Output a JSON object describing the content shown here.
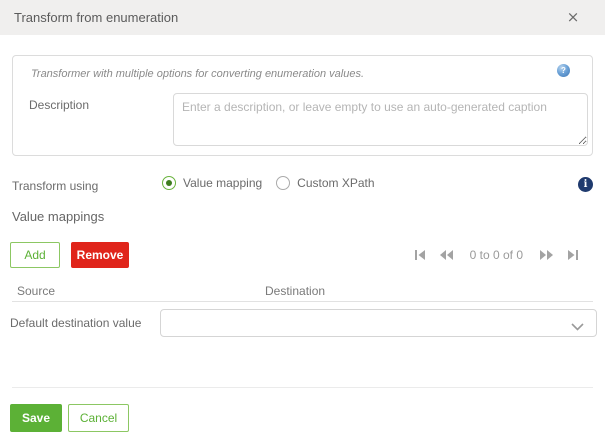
{
  "dialog": {
    "title": "Transform from enumeration"
  },
  "icons": {
    "close_glyph": "×",
    "help_glyph": "?",
    "info_glyph": "i",
    "pagination_first": "first-page-icon",
    "pagination_prev": "previous-page-icon",
    "pagination_next": "next-page-icon",
    "pagination_last": "last-page-icon",
    "chevron_down": "chevron-down-icon"
  },
  "info_panel": {
    "hint": "Transformer with multiple options for converting enumeration values.",
    "description_label": "Description",
    "description_placeholder": "Enter a description, or leave empty to use an auto-generated caption",
    "description_value": ""
  },
  "transform_using": {
    "label": "Transform using",
    "options": [
      {
        "label": "Value mapping",
        "selected": true
      },
      {
        "label": "Custom XPath",
        "selected": false
      }
    ]
  },
  "value_mappings": {
    "heading": "Value mappings",
    "add_label": "Add",
    "remove_label": "Remove",
    "pagination": {
      "range_text": "0 to 0 of 0"
    },
    "table": {
      "columns": [
        "Source",
        "Destination"
      ],
      "rows": [
        {
          "source": "Default destination value",
          "destination_value": ""
        }
      ]
    }
  },
  "footer": {
    "save_label": "Save",
    "cancel_label": "Cancel"
  },
  "colors": {
    "accent_green": "#5cb136",
    "danger_red": "#e0251b",
    "titlebar_bg": "#f0efee",
    "info_navy": "#1f3a6e",
    "help_blue": "#4a86c8"
  }
}
